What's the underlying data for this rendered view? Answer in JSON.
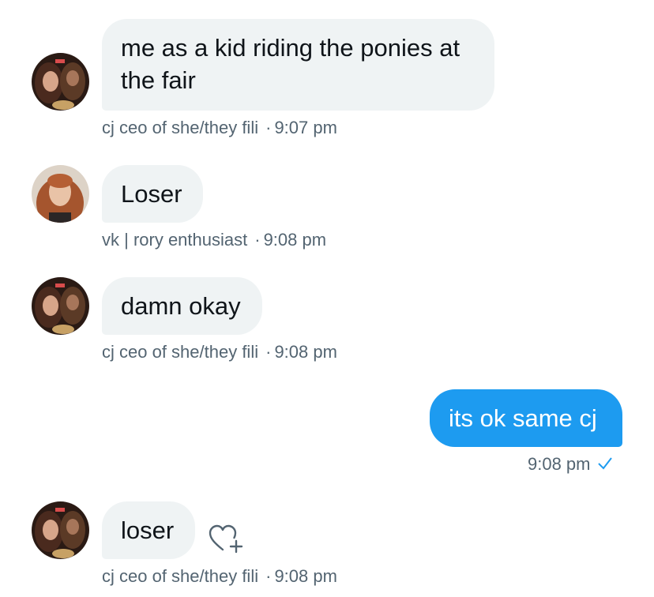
{
  "messages": [
    {
      "direction": "incoming",
      "sender": "cj ceo of she/they fili",
      "avatar": "user-avatar-cj",
      "text": "me as a kid riding the ponies at the fair",
      "time": "9:07 pm"
    },
    {
      "direction": "incoming",
      "sender": "vk | rory enthusiast",
      "avatar": "user-avatar-vk",
      "text": "Loser",
      "time": "9:08 pm"
    },
    {
      "direction": "incoming",
      "sender": "cj ceo of she/they fili",
      "avatar": "user-avatar-cj",
      "text": "damn okay",
      "time": "9:08 pm"
    },
    {
      "direction": "outgoing",
      "text": "its ok same cj",
      "time": "9:08 pm",
      "status_icon": "checkmark-icon"
    },
    {
      "direction": "incoming",
      "sender": "cj ceo of she/they fili",
      "avatar": "user-avatar-cj",
      "text": "loser",
      "time": "9:08 pm",
      "reaction_icon": "add-reaction-heart-icon"
    }
  ],
  "separator": "·",
  "colors": {
    "incoming_bubble": "#eff3f4",
    "outgoing_bubble": "#1d9bf0",
    "meta_text": "#536471",
    "message_text": "#0f1419"
  }
}
